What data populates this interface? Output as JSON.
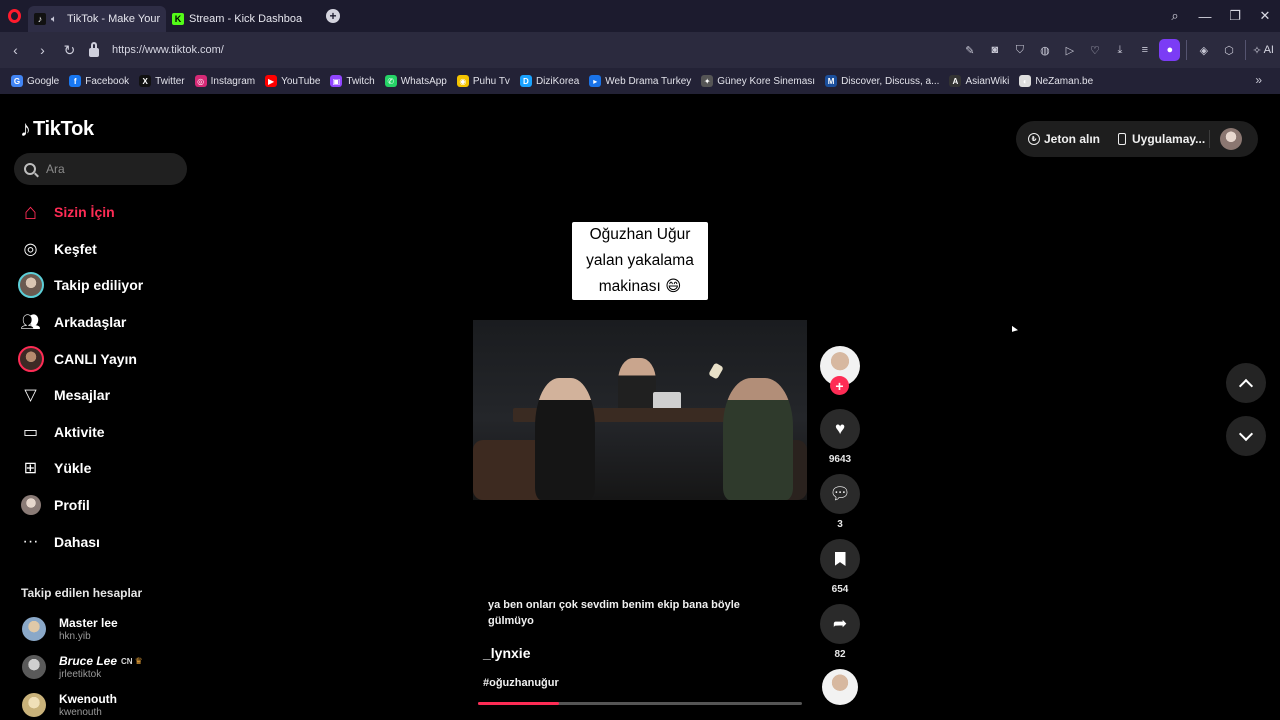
{
  "browser": {
    "tabs": [
      {
        "label": "TikTok - Make Your Da",
        "active": true
      },
      {
        "label": "Stream - Kick Dashboard",
        "active": false
      }
    ],
    "new_tab_label": "+",
    "window_controls": {
      "minimize": "—",
      "restore": "❐",
      "close": "✕"
    },
    "url": "https://www.tiktok.com/",
    "ai_label": "AI",
    "bookmarks": [
      {
        "label": "Google",
        "color": "#4285f4",
        "glyph": "G"
      },
      {
        "label": "Facebook",
        "color": "#1877f2",
        "glyph": "f"
      },
      {
        "label": "Twitter",
        "color": "#111111",
        "glyph": "X"
      },
      {
        "label": "Instagram",
        "color": "#d62976",
        "glyph": "◎"
      },
      {
        "label": "YouTube",
        "color": "#ff0000",
        "glyph": "▶"
      },
      {
        "label": "Twitch",
        "color": "#9146ff",
        "glyph": "▣"
      },
      {
        "label": "WhatsApp",
        "color": "#25d366",
        "glyph": "✆"
      },
      {
        "label": "Puhu Tv",
        "color": "#f5c400",
        "glyph": "◉"
      },
      {
        "label": "DiziKorea",
        "color": "#1aa3ff",
        "glyph": "D"
      },
      {
        "label": "Web Drama Turkey",
        "color": "#1a73e8",
        "glyph": "▸"
      },
      {
        "label": "Güney Kore Sineması",
        "color": "#555555",
        "glyph": "✦"
      },
      {
        "label": "Discover, Discuss, a...",
        "color": "#1b4f9c",
        "glyph": "M"
      },
      {
        "label": "AsianWiki",
        "color": "#333333",
        "glyph": "A"
      },
      {
        "label": "NeZaman.be",
        "color": "#dddddd",
        "glyph": "◐"
      }
    ],
    "bookmarks_more": "»"
  },
  "tiktok": {
    "logo_text": "TikTok",
    "search_placeholder": "Ara",
    "nav": [
      {
        "label": "Sizin İçin",
        "icon": "home-icon",
        "active": true
      },
      {
        "label": "Keşfet",
        "icon": "compass-icon",
        "active": false
      },
      {
        "label": "Takip ediliyor",
        "icon": "following-avatar",
        "active": false
      },
      {
        "label": "Arkadaşlar",
        "icon": "friends-icon",
        "active": false
      },
      {
        "label": "CANLI Yayın",
        "icon": "live-avatar",
        "active": false
      },
      {
        "label": "Mesajlar",
        "icon": "send-icon",
        "active": false
      },
      {
        "label": "Aktivite",
        "icon": "activity-icon",
        "active": false
      },
      {
        "label": "Yükle",
        "icon": "upload-icon",
        "active": false
      },
      {
        "label": "Profil",
        "icon": "profile-avatar",
        "active": false
      },
      {
        "label": "Dahası",
        "icon": "more-icon",
        "active": false
      }
    ],
    "following_title": "Takip edilen hesaplar",
    "following": [
      {
        "name": "Master lee",
        "handle": "hkn.yib",
        "badge": "",
        "avatar_color": "#8aa8c8"
      },
      {
        "name": "Bruce Lee",
        "handle": "jrleetiktok",
        "badge": "CN",
        "avatar_color": "#9a9a9a"
      },
      {
        "name": "Kwenouth",
        "handle": "kwenouth",
        "badge": "",
        "avatar_color": "#c9b27a"
      }
    ],
    "top_right": {
      "coins": "Jeton alın",
      "app": "Uygulamay..."
    }
  },
  "video": {
    "caption_lines": [
      "Oğuzhan Uğur",
      "yalan yakalama",
      "makinası 😄"
    ],
    "description": "ya ben onları çok sevdim benim ekip bana böyle gülmüyo",
    "author": "_lynxie",
    "hashtag": "#oğuzhanuğur",
    "progress": 0.25,
    "actions": {
      "likes": "9643",
      "comments": "3",
      "saves": "654",
      "shares": "82"
    },
    "accent": "#fe2c55"
  }
}
